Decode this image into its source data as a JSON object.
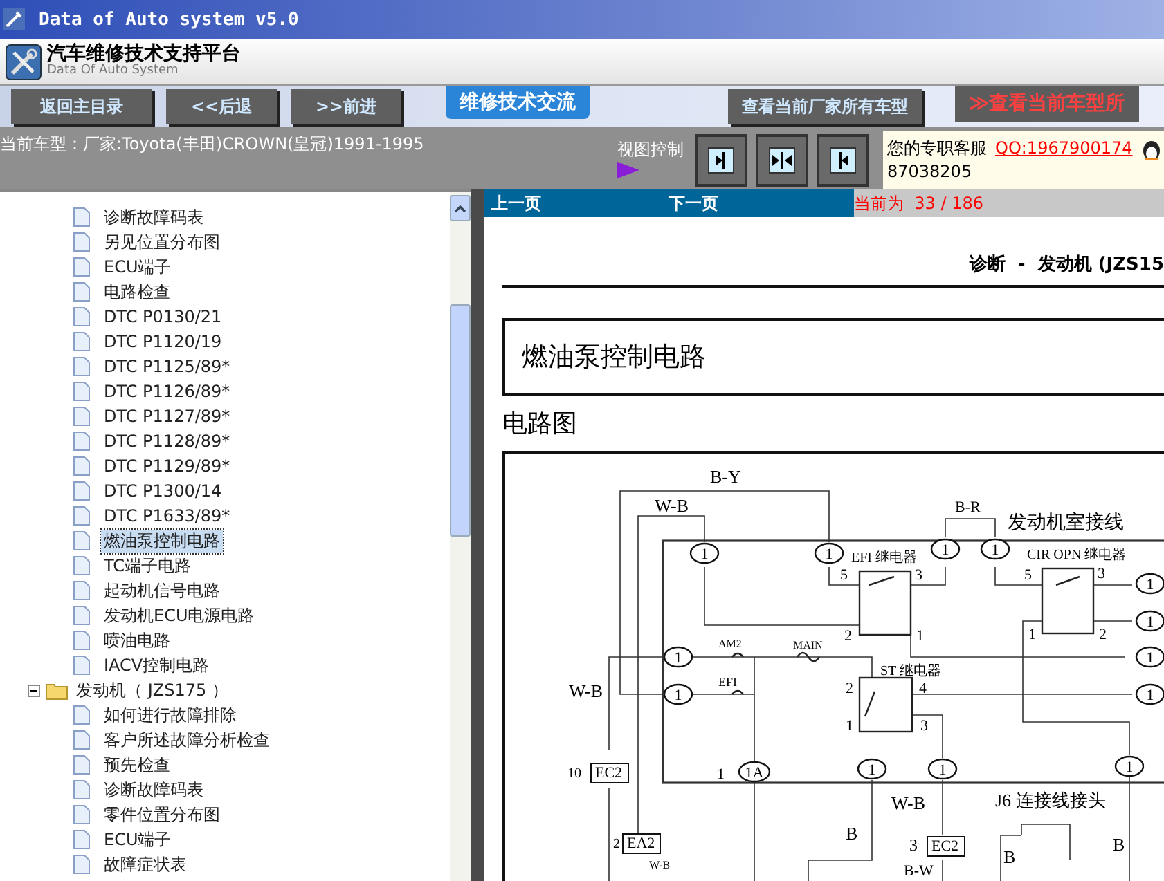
{
  "window": {
    "title": "Data of Auto system v5.0"
  },
  "header": {
    "title": "汽车维修技术支持平台",
    "subtitle": "Data Of Auto System"
  },
  "nav_buttons": [
    {
      "label": "返回主目录",
      "kind": "gray"
    },
    {
      "label": "<<后退",
      "kind": "gray"
    },
    {
      "label": ">>前进",
      "kind": "gray"
    },
    {
      "label": "维修技术交流",
      "kind": "blue"
    },
    {
      "label": "查看当前厂家所有车型",
      "kind": "gray"
    },
    {
      "label": "≫查看当前车型所",
      "kind": "red"
    }
  ],
  "info_bar": {
    "current_model": "当前车型：厂家:Toyota(丰田)CROWN(皇冠)1991-1995",
    "view_control": "视图控制",
    "service_label": "您的专职客服",
    "qq": "QQ:1967900174",
    "phone": "87038205"
  },
  "tree": [
    {
      "children": [
        {
          "label": "诊断故障码表",
          "selected": false
        },
        {
          "label": "另见位置分布图",
          "selected": false
        },
        {
          "label": "ECU端子",
          "selected": false
        },
        {
          "label": "电路检查",
          "selected": false
        },
        {
          "label": "DTC P0130/21",
          "selected": false
        },
        {
          "label": "DTC P1120/19",
          "selected": false
        },
        {
          "label": "DTC P1125/89*",
          "selected": false
        },
        {
          "label": "DTC P1126/89*",
          "selected": false
        },
        {
          "label": "DTC P1127/89*",
          "selected": false
        },
        {
          "label": "DTC P1128/89*",
          "selected": false
        },
        {
          "label": "DTC P1129/89*",
          "selected": false
        },
        {
          "label": "DTC P1300/14",
          "selected": false
        },
        {
          "label": "DTC P1633/89*",
          "selected": false
        },
        {
          "label": "燃油泵控制电路",
          "selected": true
        },
        {
          "label": "TC端子电路",
          "selected": false
        },
        {
          "label": "起动机信号电路",
          "selected": false
        },
        {
          "label": "发动机ECU电源电路",
          "selected": false
        },
        {
          "label": "喷油电路",
          "selected": false
        },
        {
          "label": "IACV控制电路",
          "selected": false
        }
      ]
    },
    {
      "label": "发动机（ JZS175 ）",
      "expanded": true,
      "selected": false,
      "children": [
        {
          "label": "如何进行故障排除",
          "selected": false
        },
        {
          "label": "客户所述故障分析检查",
          "selected": false
        },
        {
          "label": "预先检查",
          "selected": false
        },
        {
          "label": "诊断故障码表",
          "selected": false
        },
        {
          "label": "零件位置分布图",
          "selected": false
        },
        {
          "label": "ECU端子",
          "selected": false
        },
        {
          "label": "故障症状表",
          "selected": false
        }
      ]
    }
  ],
  "pager": {
    "prev": "上一页",
    "next": "下一页",
    "position": "当前为  33 / 186"
  },
  "document": {
    "header": "诊断  -  发动机 (JZS15",
    "title": "燃油泵控制电路",
    "section": "电路图",
    "diagram": {
      "labels": [
        "B-Y",
        "W-B",
        "B-R",
        "发动机室接线",
        "EFI 继电器",
        "CIR OPN 继电器",
        "AM2",
        "MAIN",
        "EFI",
        "ST 继电器",
        "W-B",
        "10",
        "EC2",
        "W-B",
        "J6 连接线接头",
        "2",
        "EA2",
        "3",
        "EC2",
        "B",
        "B",
        "B",
        "B-W",
        "5",
        "3",
        "2",
        "1",
        "5",
        "3",
        "1",
        "2",
        "2",
        "4",
        "1",
        "3",
        "1",
        "W-B"
      ],
      "connectors": [
        "1",
        "1",
        "1",
        "1",
        "1",
        "1",
        "1",
        "1",
        "1",
        "1",
        "1A",
        "1",
        "1",
        "1"
      ]
    }
  }
}
